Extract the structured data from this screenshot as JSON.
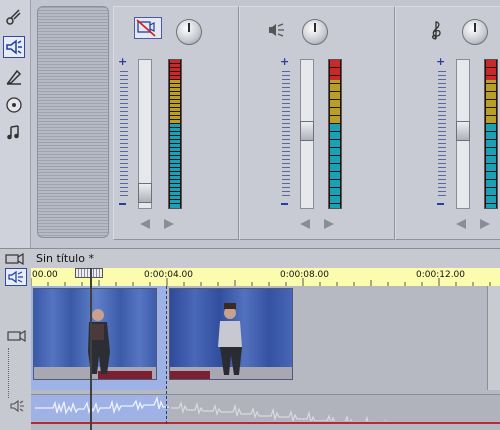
{
  "toolbar": {
    "tools": [
      {
        "icon": "scissors-icon",
        "active": false
      },
      {
        "icon": "speaker-icon",
        "active": true
      },
      {
        "icon": "title-pen-icon",
        "active": false
      },
      {
        "icon": "disc-icon",
        "active": false
      },
      {
        "icon": "music-note-icon",
        "active": false
      }
    ]
  },
  "mixer": {
    "channels": [
      {
        "icon": "video-audio-icon",
        "fader_level": 0.12
      },
      {
        "icon": "narration-icon",
        "fader_level": 0.56
      },
      {
        "icon": "music-clef-icon",
        "fader_level": 0.56
      }
    ]
  },
  "timeline": {
    "project_title": "Sin título *",
    "ruler_labels": [
      "00.00",
      "0:00:04.00",
      "0:00:08.00",
      "0:00:12.00"
    ]
  },
  "colors": {
    "ruler_bg": "#fcfcae",
    "selection": "#9fb2e6",
    "accent": "#2f4aa0"
  }
}
